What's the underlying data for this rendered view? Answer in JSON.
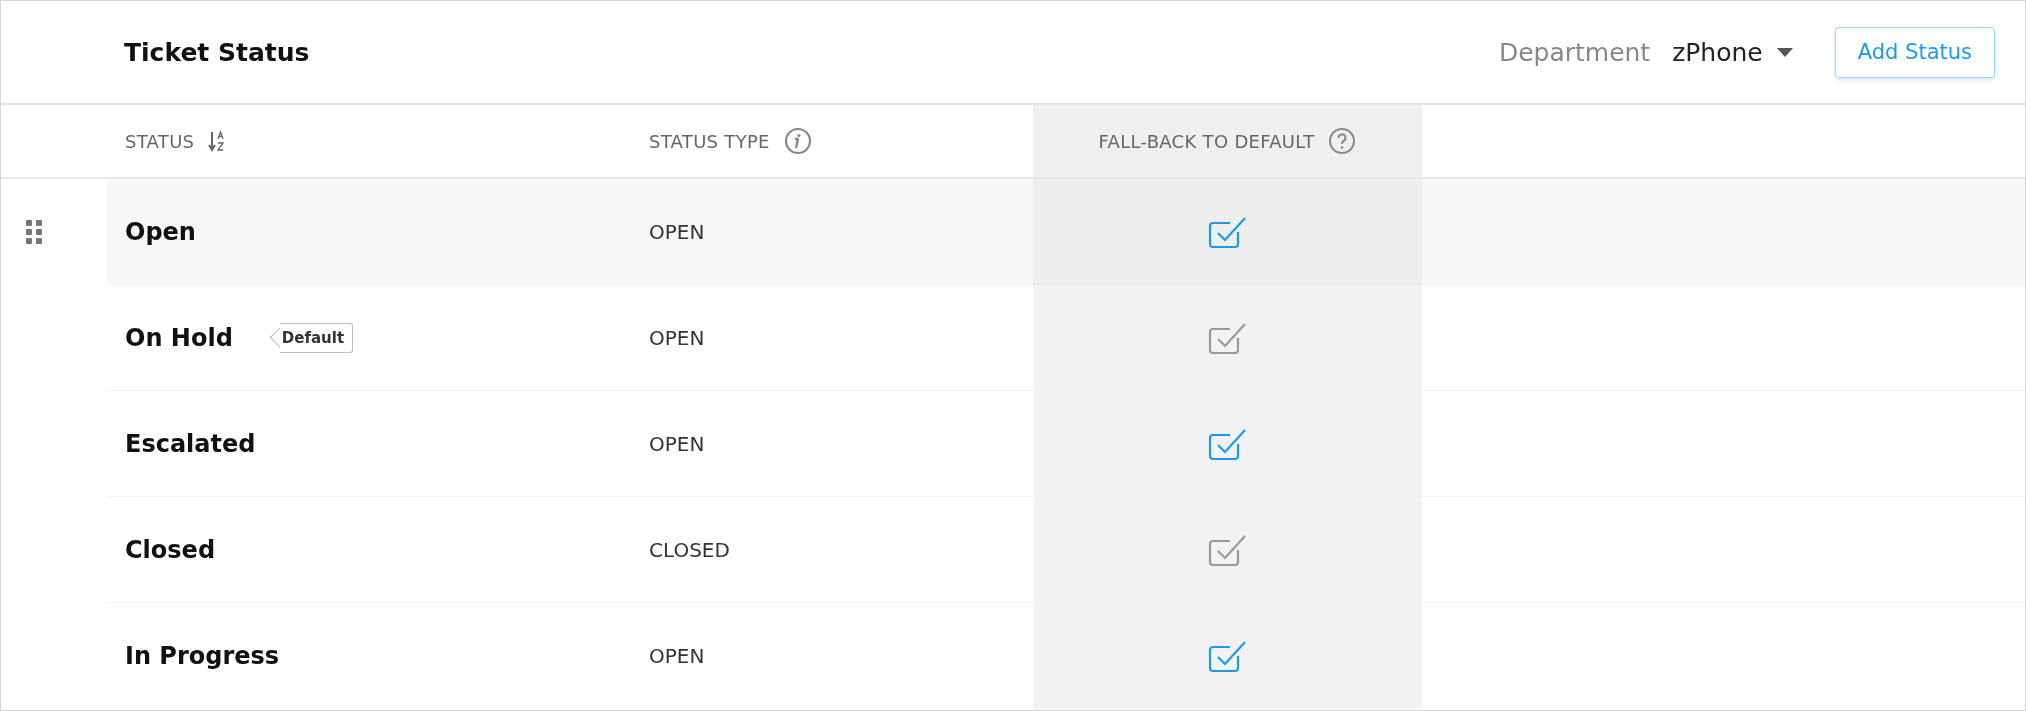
{
  "title": "Ticket Status",
  "department": {
    "label": "Department",
    "value": "zPhone"
  },
  "add_button": "Add Status",
  "columns": [
    {
      "label": "STATUS",
      "kind": "sort"
    },
    {
      "label": "STATUS TYPE",
      "kind": "info"
    },
    {
      "label": "FALL-BACK TO DEFAULT",
      "kind": "help"
    }
  ],
  "rows": [
    {
      "name": "Open",
      "type": "OPEN",
      "fallback": true,
      "highlighted": true
    },
    {
      "name": "On Hold",
      "badge": "Default",
      "type": "OPEN",
      "fallback": false,
      "highlighted": false
    },
    {
      "name": "Escalated",
      "type": "OPEN",
      "fallback": true,
      "highlighted": false
    },
    {
      "name": "Closed",
      "type": "CLOSED",
      "fallback": false,
      "highlighted": false
    },
    {
      "name": "In Progress",
      "type": "OPEN",
      "fallback": true,
      "highlighted": false
    }
  ]
}
